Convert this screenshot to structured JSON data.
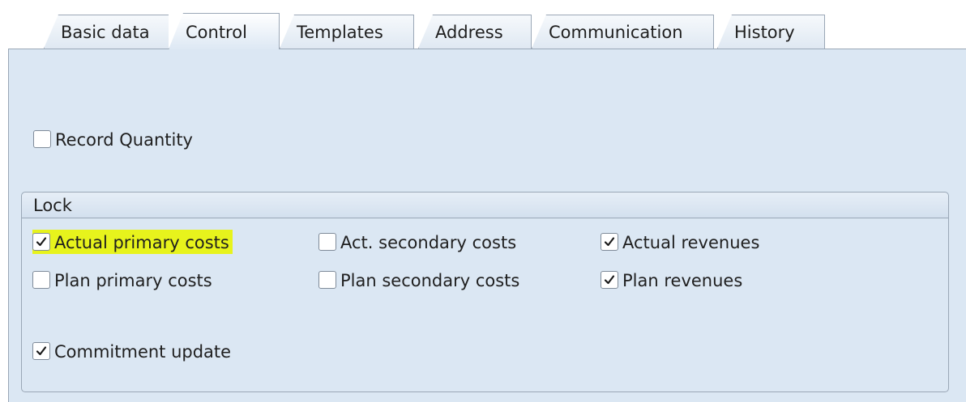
{
  "tabs": [
    {
      "label": "Basic data",
      "active": false
    },
    {
      "label": "Control",
      "active": true
    },
    {
      "label": "Templates",
      "active": false
    },
    {
      "label": "Address",
      "active": false
    },
    {
      "label": "Communication",
      "active": false
    },
    {
      "label": "History",
      "active": false
    }
  ],
  "control": {
    "record_quantity": {
      "label": "Record Quantity",
      "checked": false
    }
  },
  "lock": {
    "title": "Lock",
    "actual_primary_costs": {
      "label": "Actual primary costs",
      "checked": true,
      "highlighted": true
    },
    "act_secondary_costs": {
      "label": "Act. secondary costs",
      "checked": false
    },
    "actual_revenues": {
      "label": "Actual revenues",
      "checked": true
    },
    "plan_primary_costs": {
      "label": "Plan primary costs",
      "checked": false
    },
    "plan_secondary_costs": {
      "label": "Plan secondary costs",
      "checked": false
    },
    "plan_revenues": {
      "label": "Plan revenues",
      "checked": true
    },
    "commitment_update": {
      "label": "Commitment update",
      "checked": true
    }
  },
  "colors": {
    "panel_background": "#dbe7f3",
    "border": "#9aa7b6",
    "highlight": "#e7f31c"
  },
  "icons": {
    "checkmark": "checkmark-icon"
  }
}
